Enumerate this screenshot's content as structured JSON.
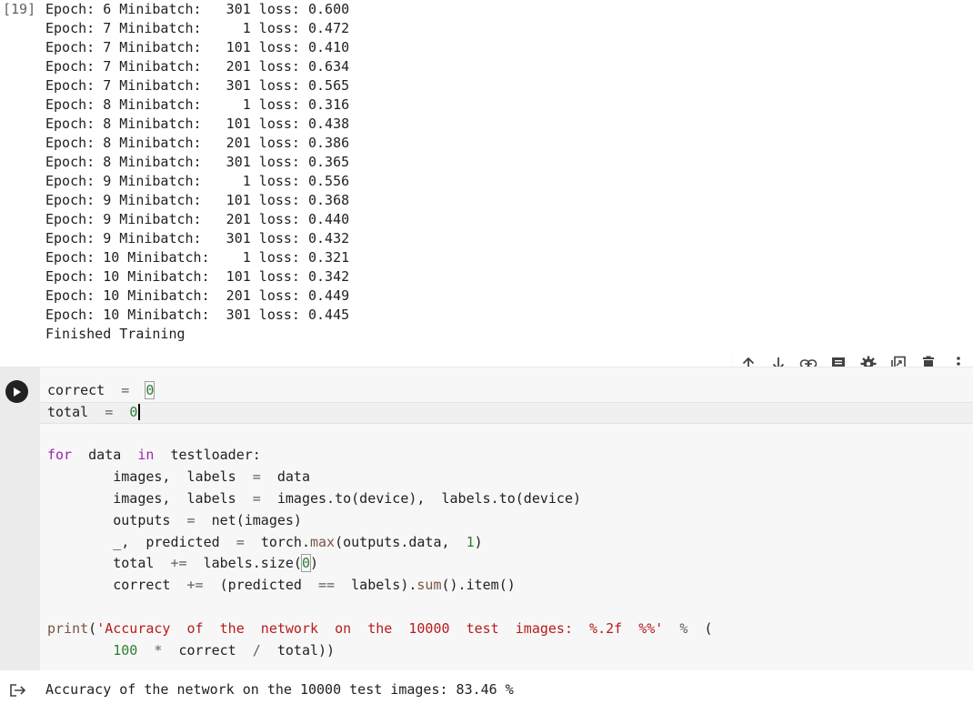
{
  "output_cell": {
    "execution_count": "[19]",
    "lines": [
      "Epoch: 6 Minibatch:   301 loss: 0.600",
      "Epoch: 7 Minibatch:     1 loss: 0.472",
      "Epoch: 7 Minibatch:   101 loss: 0.410",
      "Epoch: 7 Minibatch:   201 loss: 0.634",
      "Epoch: 7 Minibatch:   301 loss: 0.565",
      "Epoch: 8 Minibatch:     1 loss: 0.316",
      "Epoch: 8 Minibatch:   101 loss: 0.438",
      "Epoch: 8 Minibatch:   201 loss: 0.386",
      "Epoch: 8 Minibatch:   301 loss: 0.365",
      "Epoch: 9 Minibatch:     1 loss: 0.556",
      "Epoch: 9 Minibatch:   101 loss: 0.368",
      "Epoch: 9 Minibatch:   201 loss: 0.440",
      "Epoch: 9 Minibatch:   301 loss: 0.432",
      "Epoch: 10 Minibatch:    1 loss: 0.321",
      "Epoch: 10 Minibatch:  101 loss: 0.342",
      "Epoch: 10 Minibatch:  201 loss: 0.449",
      "Epoch: 10 Minibatch:  301 loss: 0.445",
      "Finished Training"
    ]
  },
  "toolbar": {
    "buttons": [
      {
        "name": "move-cell-up-icon"
      },
      {
        "name": "move-cell-down-icon"
      },
      {
        "name": "link-icon"
      },
      {
        "name": "comment-icon"
      },
      {
        "name": "settings-gear-icon"
      },
      {
        "name": "mirror-cell-icon"
      },
      {
        "name": "delete-trash-icon"
      },
      {
        "name": "more-vert-icon"
      }
    ]
  },
  "code_cell": {
    "code": {
      "l1_var": "correct",
      "l1_eq": "=",
      "l1_val": "0",
      "l2_var": "total",
      "l2_eq": "=",
      "l2_val": "0",
      "l4_for": "for",
      "l4_data": "data",
      "l4_in": "in",
      "l4_iter": "testloader:",
      "l5_lhs": "images,  labels",
      "l5_eq": "=",
      "l5_rhs": "data",
      "l6_lhs": "images,  labels",
      "l6_eq": "=",
      "l6_rhs1": "images.to(device),",
      "l6_rhs2": "labels.to(device)",
      "l7_lhs": "outputs",
      "l7_eq": "=",
      "l7_rhs": "net(images)",
      "l8_lhs": "_,  predicted",
      "l8_eq": "=",
      "l8_mod": "torch.",
      "l8_fn": "max",
      "l8_args": "(outputs.data,",
      "l8_num": "1",
      "l8_close": ")",
      "l9_lhs": "total",
      "l9_op": "+=",
      "l9_rhs": "labels.size(",
      "l9_num": "0",
      "l9_close": ")",
      "l10_lhs": "correct",
      "l10_op": "+=",
      "l10_rhs1": "(predicted",
      "l10_eqeq": "==",
      "l10_rhs2": "labels).",
      "l10_fn": "sum",
      "l10_rest": "().item()",
      "l12_print": "print",
      "l12_paren": "(",
      "l12_str": "'Accuracy  of  the  network  on  the  10000  test  images:  %.2f  %%'",
      "l12_pct": "%",
      "l12_open": "(",
      "l13_num": "100",
      "l13_mul": "*",
      "l13_correct": "correct",
      "l13_div": "/",
      "l13_total": "total))"
    }
  },
  "result": {
    "text": "Accuracy of the network on the 10000 test images: 83.46 %"
  }
}
